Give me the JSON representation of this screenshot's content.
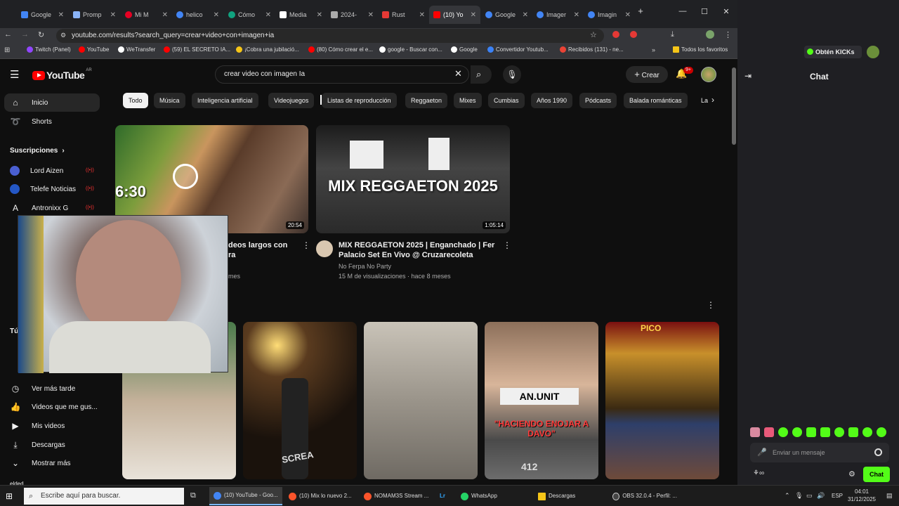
{
  "browser": {
    "tabs": [
      {
        "label": "Google",
        "color": "#4285f4"
      },
      {
        "label": "Promp",
        "color": "#8ab4f8"
      },
      {
        "label": "Mi M",
        "color": "#e60023"
      },
      {
        "label": "helico",
        "color": "#4285f4"
      },
      {
        "label": "Cómo",
        "color": "#10a37f"
      },
      {
        "label": "Media",
        "color": "#ffffff"
      },
      {
        "label": "2024-",
        "color": "#aaaaaa"
      },
      {
        "label": "Rust",
        "color": "#e53935"
      },
      {
        "label": "(10) Yo",
        "color": "#ff0000"
      },
      {
        "label": "Google",
        "color": "#4285f4"
      },
      {
        "label": "Imager",
        "color": "#4285f4"
      },
      {
        "label": "Imagin",
        "color": "#4285f4"
      }
    ],
    "url": "youtube.com/results?search_query=crear+video+con+imagen+ia",
    "bookmarks": [
      {
        "label": "Twitch (Panel)",
        "color": "#9146ff"
      },
      {
        "label": "YouTube",
        "color": "#ff0000"
      },
      {
        "label": "WeTransfer",
        "color": "#ffffff"
      },
      {
        "label": "(59) EL SECRETO IA...",
        "color": "#ff0000"
      },
      {
        "label": "¡Cobra una jubilació...",
        "color": "#f5c518"
      },
      {
        "label": "(80) Cómo crear el e...",
        "color": "#ff0000"
      },
      {
        "label": "google - Buscar con...",
        "color": "#ffffff"
      },
      {
        "label": "Google",
        "color": "#ffffff"
      },
      {
        "label": "Convertidor Youtub...",
        "color": "#3b82f6"
      },
      {
        "label": "Recibidos (131) - ne...",
        "color": "#ea4335"
      },
      {
        "label": "Todos los favoritos",
        "color": "#f5c518"
      }
    ]
  },
  "youtube": {
    "logo": "YouTube",
    "country": "AR",
    "search_value": "crear video con imagen Ia",
    "create_label": "Crear",
    "notif_count": "9+",
    "chips": [
      "Todo",
      "Música",
      "Inteligencia artificial",
      "Videojuegos",
      "Listas de reproducción",
      "Reggaeton",
      "Mixes",
      "Cumbias",
      "Años 1990",
      "Pódcasts",
      "Balada románticas",
      "La"
    ],
    "sidebar": {
      "home": "Inicio",
      "shorts": "Shorts",
      "subs_header": "Suscripciones",
      "subs": [
        "Lord Aizen",
        "Telefe Noticias",
        "Antronixx G"
      ],
      "you_partial": "Tú",
      "watch_later": "Ver más tarde",
      "liked": "Videos que me gus...",
      "my_videos": "Mis videos",
      "downloads": "Descargas",
      "show_more": "Mostrar más",
      "bottom_user": "elded"
    },
    "videos": [
      {
        "duration": "20:54",
        "title_partial": "deos largos con",
        "title_partial2": "ra",
        "meta_partial": "mes",
        "overlay": "6:30"
      },
      {
        "duration": "1:05:14",
        "overlay": "MIX REGGAETON 2025",
        "title": "MIX REGGAETON 2025 | Enganchado | Fer Palacio Set En Vivo @ Cruzarecoleta",
        "channel": "No Ferpa No Party",
        "meta": "15 M de visualizaciones · hace 8 meses"
      }
    ],
    "shorts_captions": [
      "AN.UNIT",
      "\"HACIENDO ENOJAR A DAVO\"",
      "412",
      "PICO",
      "SCREA"
    ]
  },
  "kick": {
    "get_kicks": "Obtén KICKs",
    "chat_title": "Chat",
    "input_placeholder": "Enviar un mensaje",
    "chat_button": "Chat"
  },
  "taskbar": {
    "search_placeholder": "Escribe aquí para buscar.",
    "items": [
      {
        "label": "(10) YouTube - Goo...",
        "color": "#4285f4"
      },
      {
        "label": "(10) Mix lo nuevo 2...",
        "color": "#fb542b"
      },
      {
        "label": "NOMAM3S Stream ...",
        "color": "#fb542b"
      },
      {
        "label": "Lr",
        "color": "#31a8ff"
      },
      {
        "label": "WhatsApp",
        "color": "#25d366"
      },
      {
        "label": "Descargas",
        "color": "#f5c518"
      },
      {
        "label": "OBS 32.0.4 - Perfil: ...",
        "color": "#444444"
      }
    ],
    "lang": "ESP",
    "time": "04:01",
    "date": "31/12/2025"
  }
}
